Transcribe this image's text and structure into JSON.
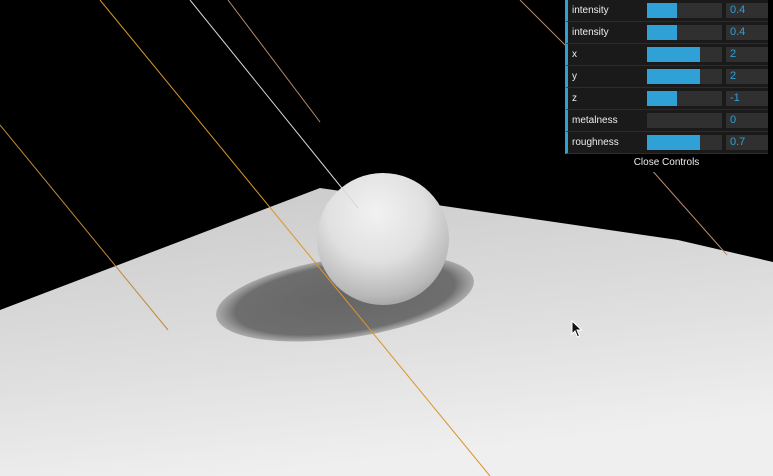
{
  "controls": {
    "rows": [
      {
        "label": "intensity",
        "value": "0.4",
        "fraction": 0.4
      },
      {
        "label": "intensity",
        "value": "0.4",
        "fraction": 0.4
      },
      {
        "label": "x",
        "value": "2",
        "fraction": 0.7
      },
      {
        "label": "y",
        "value": "2",
        "fraction": 0.7
      },
      {
        "label": "z",
        "value": "-1",
        "fraction": 0.4
      },
      {
        "label": "metalness",
        "value": "0",
        "fraction": 0.0
      },
      {
        "label": "roughness",
        "value": "0.7",
        "fraction": 0.7
      }
    ],
    "close_label": "Close Controls"
  },
  "colors": {
    "accent": "#2fa1d6",
    "panel_bg": "#1a1a1a",
    "field_bg": "#303030"
  }
}
